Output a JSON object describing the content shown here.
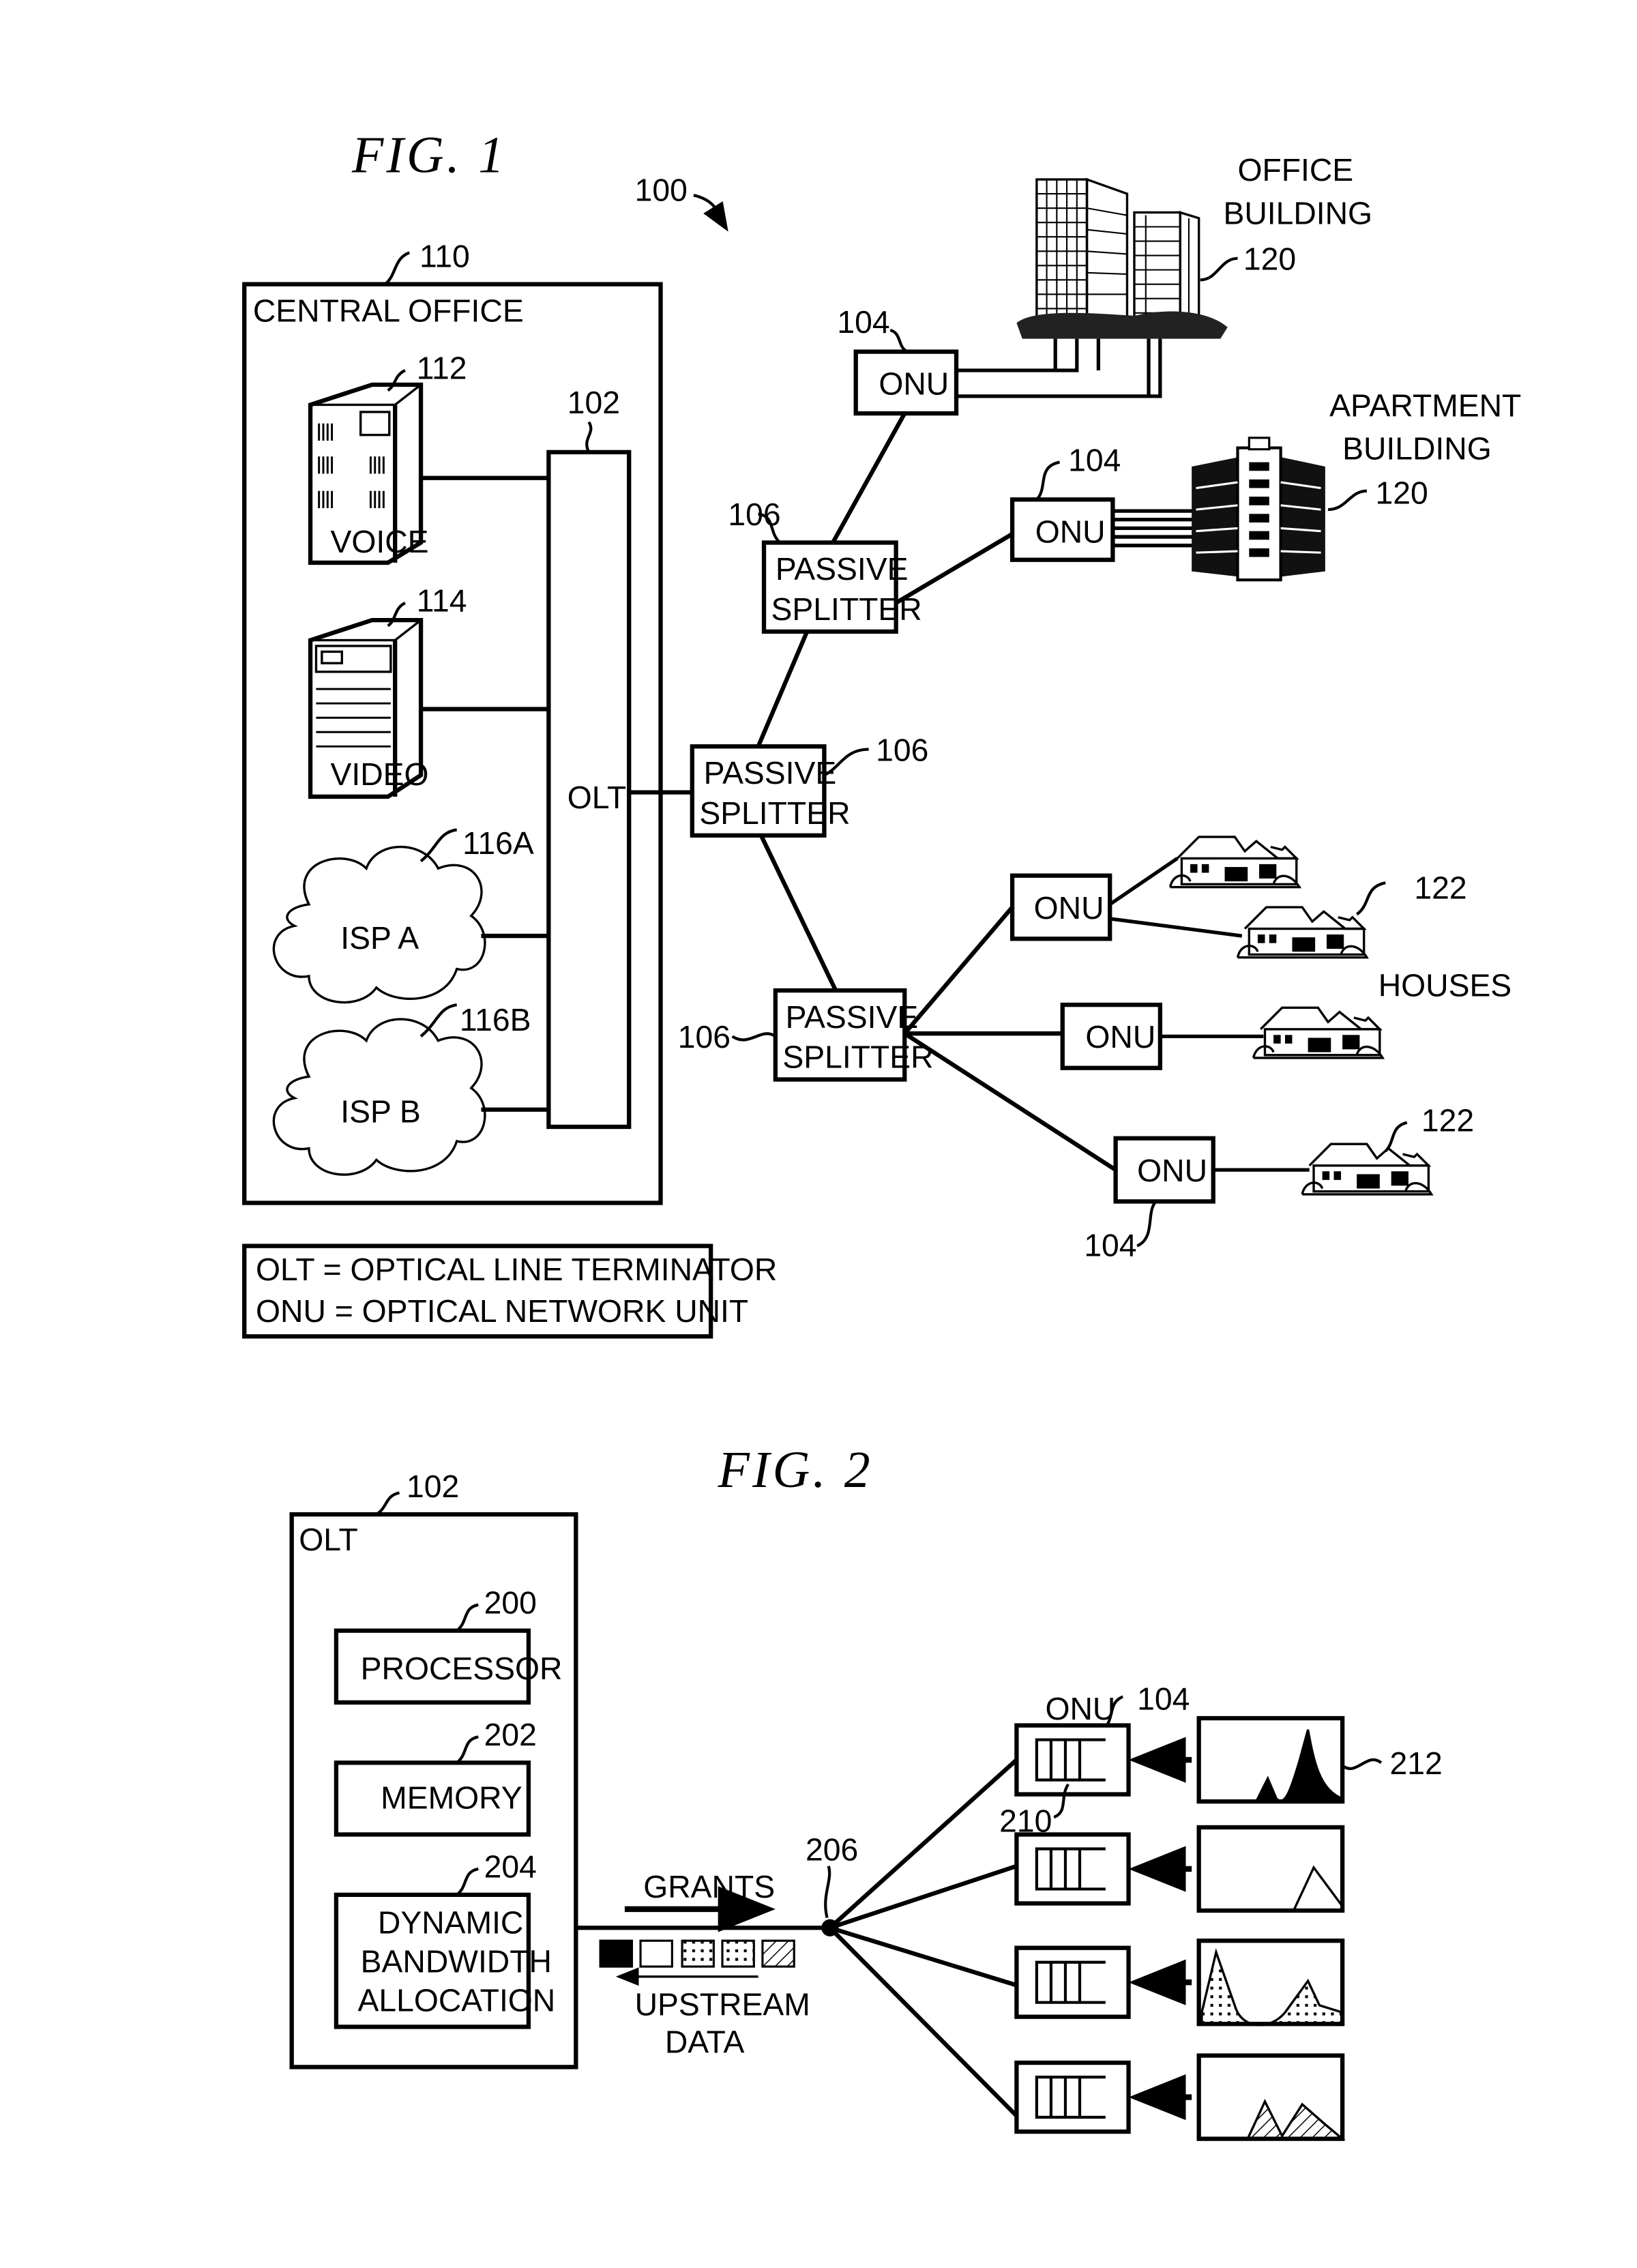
{
  "fig1": {
    "title": "FIG.  1",
    "system_ref": "100",
    "central_office": {
      "label": "CENTRAL OFFICE",
      "ref": "110"
    },
    "voice": {
      "label": "VOICE",
      "ref": "112"
    },
    "video": {
      "label": "VIDEO",
      "ref": "114"
    },
    "isp_a": {
      "label": "ISP  A",
      "ref": "116A"
    },
    "isp_b": {
      "label": "ISP  B",
      "ref": "116B"
    },
    "olt": {
      "label": "OLT",
      "ref": "102"
    },
    "splitters": [
      {
        "line1": "PASSIVE",
        "line2": "SPLITTER",
        "ref": "106"
      },
      {
        "line1": "PASSIVE",
        "line2": "SPLITTER",
        "ref": "106"
      },
      {
        "line1": "PASSIVE",
        "line2": "SPLITTER",
        "ref": "106"
      }
    ],
    "onus": [
      {
        "label": "ONU",
        "ref": "104"
      },
      {
        "label": "ONU",
        "ref": "104"
      },
      {
        "label": "ONU",
        "ref": ""
      },
      {
        "label": "ONU",
        "ref": ""
      },
      {
        "label": "ONU",
        "ref": "104"
      }
    ],
    "office_building": {
      "line1": "OFFICE",
      "line2": "BUILDING",
      "ref": "120"
    },
    "apartment_building": {
      "line1": "APARTMENT",
      "line2": "BUILDING",
      "ref": "120"
    },
    "houses": {
      "label": "HOUSES",
      "ref_top": "122",
      "ref_bottom": "122"
    },
    "legend": {
      "line1": "OLT  =  OPTICAL  LINE  TERMINATOR",
      "line2": "ONU  =  OPTICAL  NETWORK  UNIT"
    }
  },
  "fig2": {
    "title": "FIG.  2",
    "olt": {
      "label": "OLT",
      "ref": "102"
    },
    "processor": {
      "label": "PROCESSOR",
      "ref": "200"
    },
    "memory": {
      "label": "MEMORY",
      "ref": "202"
    },
    "dba": {
      "line1": "DYNAMIC",
      "line2": "BANDWIDTH",
      "line3": "ALLOCATION",
      "ref": "204"
    },
    "grants_label": "GRANTS",
    "upstream_label_1": "UPSTREAM",
    "upstream_label_2": "DATA",
    "splitter_ref": "206",
    "onu_label": "ONU",
    "onu_ref": "104",
    "queue_ref": "210",
    "traffic_ref": "212",
    "upstream_blocks": [
      "solid",
      "empty",
      "dotted",
      "dotted",
      "hatched"
    ],
    "traffic_profiles": [
      "solid-peaks",
      "single-peak-outline",
      "dotted-two-peaks",
      "hatched-two-peaks"
    ]
  }
}
